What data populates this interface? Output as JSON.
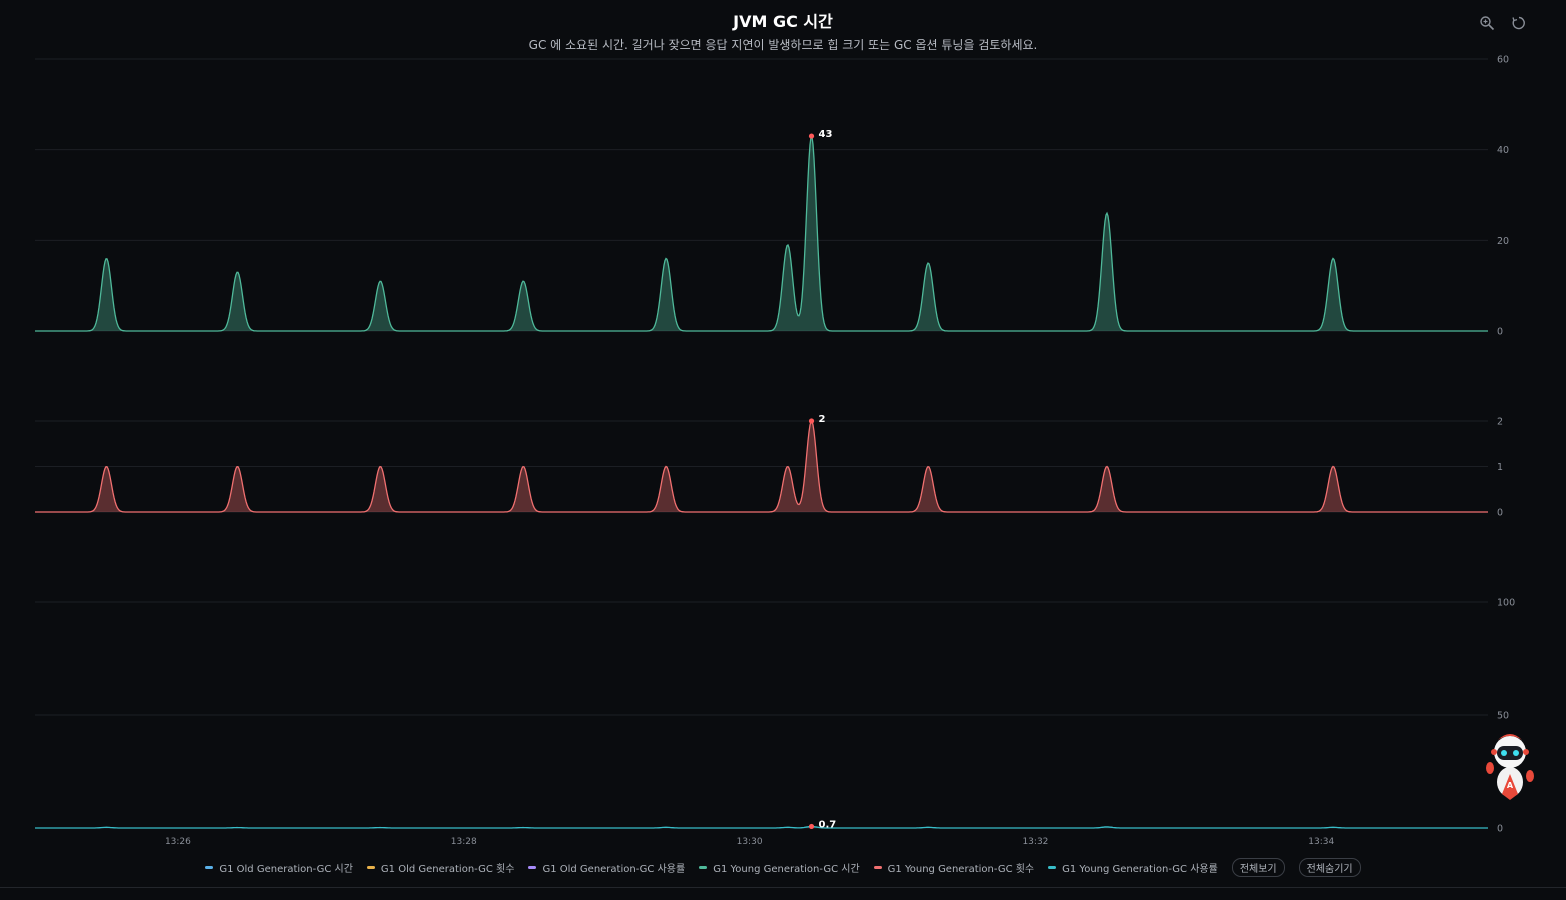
{
  "header": {
    "title": "JVM GC 시간",
    "subtitle": "GC 에 소요된 시간. 길거나 잦으면 응답 지연이 발생하므로 힙 크기 또는 GC 옵션 튜닝을 검토하세요."
  },
  "toolbar": {
    "zoom_icon": "zoom-icon",
    "reset_icon": "restore-icon"
  },
  "colors": {
    "background": "#0a0c0f",
    "grid": "#1c1f24",
    "axis_text": "#8a8f98",
    "old_time": "#5ab0e8",
    "old_count": "#e8b14a",
    "old_usage": "#a78bfa",
    "young_time": "#4fb99a",
    "young_count": "#f07070",
    "young_usage": "#38bdc8"
  },
  "chart_data": [
    {
      "type": "area",
      "panel": "gc-time",
      "ylim": [
        0,
        60
      ],
      "yticks": [
        0,
        20,
        40,
        60
      ],
      "series": [
        {
          "name": "G1 Young Generation-GC 시간",
          "color_key": "young_time",
          "peaks": [
            {
              "x": "13:25:30",
              "y": 16
            },
            {
              "x": "13:26:25",
              "y": 13
            },
            {
              "x": "13:27:25",
              "y": 11
            },
            {
              "x": "13:28:25",
              "y": 11
            },
            {
              "x": "13:29:25",
              "y": 16
            },
            {
              "x": "13:30:16",
              "y": 19
            },
            {
              "x": "13:30:26",
              "y": 43
            },
            {
              "x": "13:31:15",
              "y": 15
            },
            {
              "x": "13:32:30",
              "y": 26
            },
            {
              "x": "13:34:05",
              "y": 16
            }
          ]
        }
      ],
      "max_label": {
        "x": "13:30:26",
        "y": 43,
        "text": "43"
      }
    },
    {
      "type": "area",
      "panel": "gc-count",
      "ylim": [
        0,
        2
      ],
      "yticks": [
        0,
        1,
        2
      ],
      "series": [
        {
          "name": "G1 Young Generation-GC 횟수",
          "color_key": "young_count",
          "peaks": [
            {
              "x": "13:25:30",
              "y": 1
            },
            {
              "x": "13:26:25",
              "y": 1
            },
            {
              "x": "13:27:25",
              "y": 1
            },
            {
              "x": "13:28:25",
              "y": 1
            },
            {
              "x": "13:29:25",
              "y": 1
            },
            {
              "x": "13:30:16",
              "y": 1
            },
            {
              "x": "13:30:26",
              "y": 2
            },
            {
              "x": "13:31:15",
              "y": 1
            },
            {
              "x": "13:32:30",
              "y": 1
            },
            {
              "x": "13:34:05",
              "y": 1
            }
          ]
        }
      ],
      "max_label": {
        "x": "13:30:26",
        "y": 2,
        "text": "2"
      }
    },
    {
      "type": "area",
      "panel": "gc-usage",
      "ylim": [
        0,
        100
      ],
      "yticks": [
        0,
        50,
        100
      ],
      "series": [
        {
          "name": "G1 Young Generation-GC 사용률",
          "color_key": "young_usage",
          "peaks": [
            {
              "x": "13:25:30",
              "y": 0.3
            },
            {
              "x": "13:26:25",
              "y": 0.2
            },
            {
              "x": "13:27:25",
              "y": 0.2
            },
            {
              "x": "13:28:25",
              "y": 0.2
            },
            {
              "x": "13:29:25",
              "y": 0.3
            },
            {
              "x": "13:30:16",
              "y": 0.3
            },
            {
              "x": "13:30:26",
              "y": 0.7
            },
            {
              "x": "13:31:15",
              "y": 0.3
            },
            {
              "x": "13:32:30",
              "y": 0.5
            },
            {
              "x": "13:34:05",
              "y": 0.3
            }
          ]
        }
      ],
      "max_label": {
        "x": "13:30:26",
        "y": 0.7,
        "text": "0.7"
      }
    }
  ],
  "x_axis": {
    "range": [
      "13:25:00",
      "13:35:10"
    ],
    "ticks": [
      "13:26",
      "13:28",
      "13:30",
      "13:32",
      "13:34"
    ]
  },
  "legend": {
    "items": [
      {
        "label": "G1 Old Generation-GC 시간",
        "color_key": "old_time"
      },
      {
        "label": "G1 Old Generation-GC 횟수",
        "color_key": "old_count"
      },
      {
        "label": "G1 Old Generation-GC 사용률",
        "color_key": "old_usage"
      },
      {
        "label": "G1 Young Generation-GC 시간",
        "color_key": "young_time"
      },
      {
        "label": "G1 Young Generation-GC 횟수",
        "color_key": "young_count"
      },
      {
        "label": "G1 Young Generation-GC 사용률",
        "color_key": "young_usage"
      }
    ],
    "show_all": "전체보기",
    "hide_all": "전체숨기기"
  }
}
